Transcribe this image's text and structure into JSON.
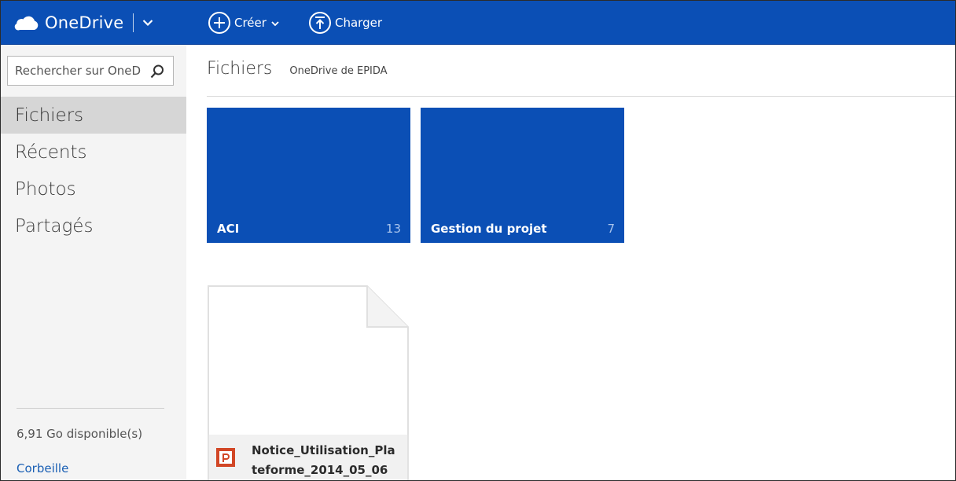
{
  "header": {
    "app_name": "OneDrive",
    "create_label": "Créer",
    "upload_label": "Charger",
    "brand_color": "#0b4fb5"
  },
  "sidebar": {
    "search_placeholder": "Rechercher sur OneDrive",
    "items": [
      {
        "label": "Fichiers",
        "active": true
      },
      {
        "label": "Récents",
        "active": false
      },
      {
        "label": "Photos",
        "active": false
      },
      {
        "label": "Partagés",
        "active": false
      }
    ],
    "storage_text": "6,91 Go disponible(s)",
    "recycle_label": "Corbeille"
  },
  "main": {
    "title": "Fichiers",
    "subtitle": "OneDrive de EPIDA",
    "folders": [
      {
        "name": "ACI",
        "count": "13"
      },
      {
        "name": "Gestion du projet",
        "count": "7"
      }
    ],
    "files": [
      {
        "name_line1": "Notice_Utilisation_Pla",
        "name_line2": "teforme_2014_05_06",
        "icon": "powerpoint-icon"
      }
    ]
  }
}
